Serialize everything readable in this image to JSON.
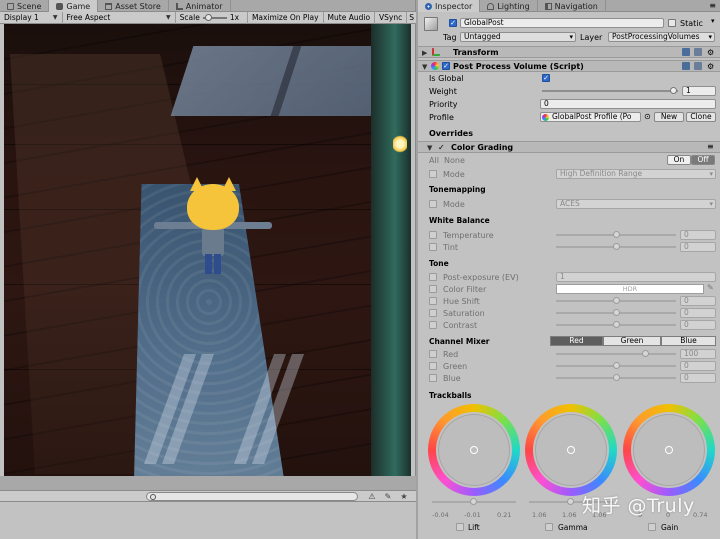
{
  "left_tabs": [
    {
      "label": "Scene",
      "icon": "scene-icon"
    },
    {
      "label": "Game",
      "icon": "game-icon"
    },
    {
      "label": "Asset Store",
      "icon": "store-icon"
    },
    {
      "label": "Animator",
      "icon": "animator-icon"
    }
  ],
  "game_toolbar": {
    "display": "Display 1",
    "aspect": "Free Aspect",
    "scale_label": "Scale",
    "scale_value": "1x",
    "maximize": "Maximize On Play",
    "mute": "Mute Audio",
    "vsync": "VSync"
  },
  "right_tabs": [
    {
      "label": "Inspector",
      "icon": "inspector-icon"
    },
    {
      "label": "Lighting",
      "icon": "lighting-icon"
    },
    {
      "label": "Navigation",
      "icon": "navigation-icon"
    }
  ],
  "inspector": {
    "object_name": "GlobalPost",
    "static_label": "Static",
    "tag_label": "Tag",
    "tag_value": "Untagged",
    "layer_label": "Layer",
    "layer_value": "PostProcessingVolumes",
    "transform_label": "Transform",
    "component_title": "Post Process Volume (Script)",
    "is_global_label": "Is Global",
    "weight_label": "Weight",
    "weight_value": "1",
    "weight_fraction": 1.0,
    "priority_label": "Priority",
    "priority_value": "0",
    "profile_label": "Profile",
    "profile_value": "GlobalPost Profile (Po",
    "new_btn": "New",
    "clone_btn": "Clone",
    "overrides_label": "Overrides",
    "color_grading_label": "Color Grading",
    "all_label": "All",
    "none_label": "None",
    "on_label": "On",
    "off_label": "Off",
    "mode_label": "Mode",
    "mode_value": "High Definition Range",
    "tonemapping_header": "Tonemapping",
    "tonemap_mode_label": "Mode",
    "tonemap_mode_value": "ACES",
    "white_balance_header": "White Balance",
    "temperature_label": "Temperature",
    "temperature_value": "0",
    "tint_label": "Tint",
    "tint_value": "0",
    "tone_header": "Tone",
    "post_exposure_label": "Post-exposure (EV)",
    "post_exposure_value": "1",
    "color_filter_label": "Color Filter",
    "color_filter_value": "HDR",
    "hue_shift_label": "Hue Shift",
    "hue_shift_value": "0",
    "saturation_label": "Saturation",
    "saturation_value": "0",
    "contrast_label": "Contrast",
    "contrast_value": "0",
    "channel_mixer_header": "Channel Mixer",
    "channel_tabs": [
      "Red",
      "Green",
      "Blue"
    ],
    "red_label": "Red",
    "red_value": "100",
    "green_label": "Green",
    "green_value": "0",
    "blue_label": "Blue",
    "blue_value": "0",
    "trackballs_header": "Trackballs",
    "trackballs": [
      {
        "label": "Lift",
        "ticks": [
          "-0.04",
          "-0.01",
          "0.21"
        ]
      },
      {
        "label": "Gamma",
        "ticks": [
          "1.06",
          "1.06",
          "1.06"
        ]
      },
      {
        "label": "Gain",
        "ticks": [
          "0",
          "0",
          "0.74"
        ]
      }
    ]
  },
  "watermark": "知乎 @Truly",
  "colors": {
    "accent": "#2f68c9",
    "panel": "#c2c2c2",
    "tab_bar": "#a8a8a8"
  }
}
